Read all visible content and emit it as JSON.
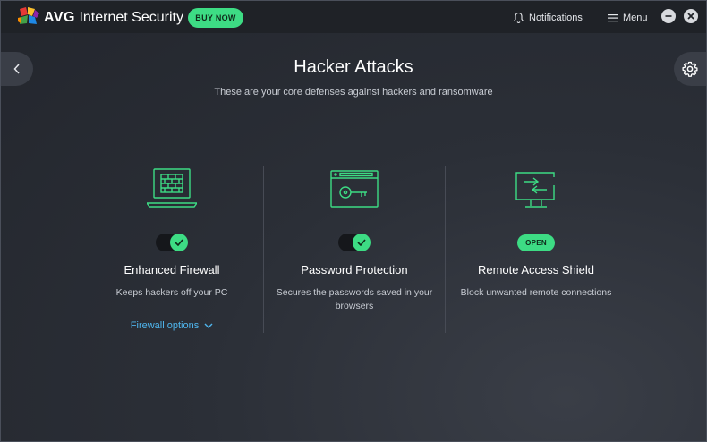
{
  "app": {
    "brand": "AVG",
    "product": "Internet Security",
    "buy_now": "BUY NOW",
    "notifications": "Notifications",
    "menu": "Menu"
  },
  "page": {
    "title": "Hacker Attacks",
    "subtitle": "These are your core defenses against hackers and ransomware"
  },
  "features": [
    {
      "name": "Enhanced Firewall",
      "description": "Keeps hackers off your PC",
      "enabled": true,
      "link": "Firewall options",
      "icon": "firewall-laptop-icon"
    },
    {
      "name": "Password Protection",
      "description": "Secures the passwords saved in your browsers",
      "enabled": true,
      "icon": "browser-key-icon"
    },
    {
      "name": "Remote Access Shield",
      "description": "Block unwanted remote connections",
      "action": "OPEN",
      "icon": "monitor-arrows-icon"
    }
  ],
  "colors": {
    "accent": "#3ddc84",
    "link": "#4fb6ee",
    "titlebar": "#1f2227",
    "background": "#2b2f37"
  }
}
